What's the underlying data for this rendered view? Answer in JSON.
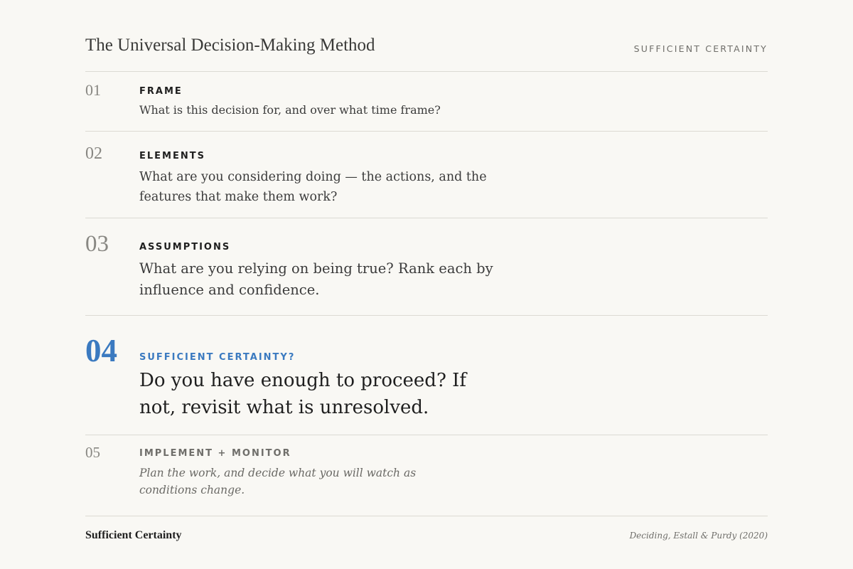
{
  "header": {
    "title": "The Universal Decision-Making Method",
    "tag": "SUFFICIENT CERTAINTY"
  },
  "steps": [
    {
      "number": "01",
      "label": "FRAME",
      "description": "What is this decision for, and over what time frame?"
    },
    {
      "number": "02",
      "label": "ELEMENTS",
      "description": "What are you considering doing — the actions, and the features that make them work?"
    },
    {
      "number": "03",
      "label": "ASSUMPTIONS",
      "description": "What are you relying on being true? Rank each by influence and confidence."
    },
    {
      "number": "04",
      "label": "SUFFICIENT CERTAINTY?",
      "description": "Do you have enough to proceed? If not, revisit what is unresolved.",
      "active": true
    },
    {
      "number": "05",
      "label": "IMPLEMENT + MONITOR",
      "description": "Plan the work, and decide what you will watch as conditions change."
    }
  ],
  "footer": {
    "left": "Sufficient Certainty",
    "right": "Deciding, Estall & Purdy (2020)"
  },
  "colors": {
    "background": "#f9f8f4",
    "accent": "#3b7ac0",
    "divider": "#dcdad3"
  }
}
